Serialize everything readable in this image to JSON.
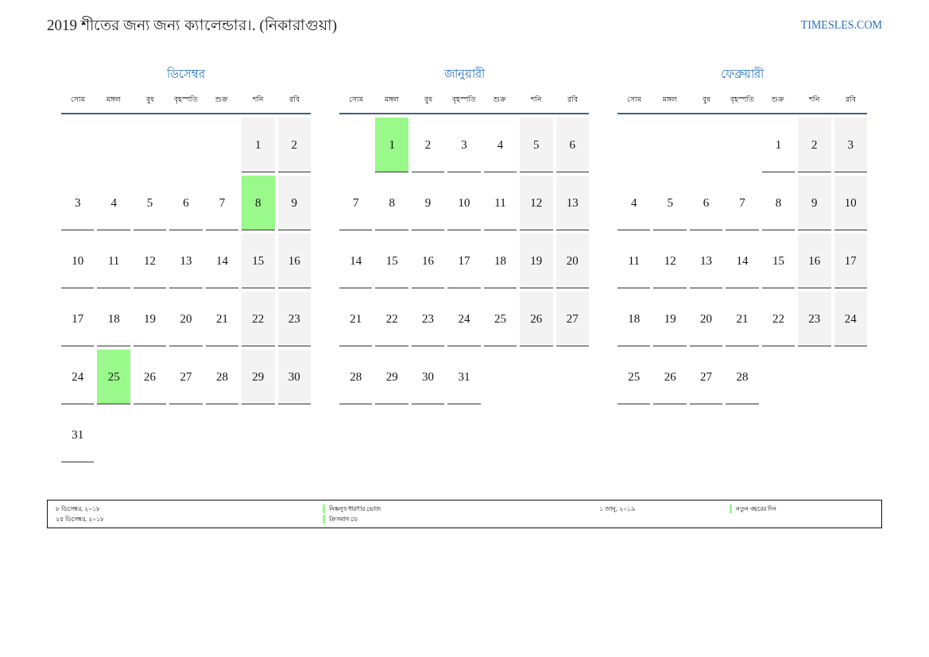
{
  "header": {
    "title": "2019 শীতের জন্য জন্য ক্যালেন্ডার।. (নিকারাগুয়া)",
    "site": "TIMESLES.COM"
  },
  "months": [
    {
      "name": "ডিসেম্বর",
      "weekdays": [
        {
          "label": "সোম",
          "weekend": false
        },
        {
          "label": "মঙ্গল",
          "weekend": false
        },
        {
          "label": "বুধ",
          "weekend": false
        },
        {
          "label": "বৃহস্পতি",
          "weekend": false
        },
        {
          "label": "শুক্র",
          "weekend": false
        },
        {
          "label": "শনি",
          "weekend": true
        },
        {
          "label": "রবি",
          "weekend": true
        }
      ],
      "weeks": [
        [
          {
            "kind": "blank"
          },
          {
            "kind": "blank"
          },
          {
            "kind": "blank"
          },
          {
            "kind": "blank"
          },
          {
            "kind": "blank"
          },
          {
            "kind": "day",
            "day": "1",
            "holiday": false
          },
          {
            "kind": "day",
            "day": "2",
            "holiday": false
          }
        ],
        [
          {
            "kind": "day",
            "day": "3",
            "holiday": false
          },
          {
            "kind": "day",
            "day": "4",
            "holiday": false
          },
          {
            "kind": "day",
            "day": "5",
            "holiday": false
          },
          {
            "kind": "day",
            "day": "6",
            "holiday": false
          },
          {
            "kind": "day",
            "day": "7",
            "holiday": false
          },
          {
            "kind": "day",
            "day": "8",
            "holiday": true
          },
          {
            "kind": "day",
            "day": "9",
            "holiday": false
          }
        ],
        [
          {
            "kind": "day",
            "day": "10",
            "holiday": false
          },
          {
            "kind": "day",
            "day": "11",
            "holiday": false
          },
          {
            "kind": "day",
            "day": "12",
            "holiday": false
          },
          {
            "kind": "day",
            "day": "13",
            "holiday": false
          },
          {
            "kind": "day",
            "day": "14",
            "holiday": false
          },
          {
            "kind": "day",
            "day": "15",
            "holiday": false
          },
          {
            "kind": "day",
            "day": "16",
            "holiday": false
          }
        ],
        [
          {
            "kind": "day",
            "day": "17",
            "holiday": false
          },
          {
            "kind": "day",
            "day": "18",
            "holiday": false
          },
          {
            "kind": "day",
            "day": "19",
            "holiday": false
          },
          {
            "kind": "day",
            "day": "20",
            "holiday": false
          },
          {
            "kind": "day",
            "day": "21",
            "holiday": false
          },
          {
            "kind": "day",
            "day": "22",
            "holiday": false
          },
          {
            "kind": "day",
            "day": "23",
            "holiday": false
          }
        ],
        [
          {
            "kind": "day",
            "day": "24",
            "holiday": false
          },
          {
            "kind": "day",
            "day": "25",
            "holiday": true
          },
          {
            "kind": "day",
            "day": "26",
            "holiday": false
          },
          {
            "kind": "day",
            "day": "27",
            "holiday": false
          },
          {
            "kind": "day",
            "day": "28",
            "holiday": false
          },
          {
            "kind": "day",
            "day": "29",
            "holiday": false
          },
          {
            "kind": "day",
            "day": "30",
            "holiday": false
          }
        ],
        [
          {
            "kind": "day",
            "day": "31",
            "holiday": false
          }
        ]
      ]
    },
    {
      "name": "জানুয়ারী",
      "weekdays": [
        {
          "label": "সোম",
          "weekend": false
        },
        {
          "label": "মঙ্গল",
          "weekend": false
        },
        {
          "label": "বুধ",
          "weekend": false
        },
        {
          "label": "বৃহস্পতি",
          "weekend": false
        },
        {
          "label": "শুক্র",
          "weekend": false
        },
        {
          "label": "শনি",
          "weekend": true
        },
        {
          "label": "রবি",
          "weekend": true
        }
      ],
      "weeks": [
        [
          {
            "kind": "blank"
          },
          {
            "kind": "day",
            "day": "1",
            "holiday": true
          },
          {
            "kind": "day",
            "day": "2",
            "holiday": false
          },
          {
            "kind": "day",
            "day": "3",
            "holiday": false
          },
          {
            "kind": "day",
            "day": "4",
            "holiday": false
          },
          {
            "kind": "day",
            "day": "5",
            "holiday": false
          },
          {
            "kind": "day",
            "day": "6",
            "holiday": false
          }
        ],
        [
          {
            "kind": "day",
            "day": "7",
            "holiday": false
          },
          {
            "kind": "day",
            "day": "8",
            "holiday": false
          },
          {
            "kind": "day",
            "day": "9",
            "holiday": false
          },
          {
            "kind": "day",
            "day": "10",
            "holiday": false
          },
          {
            "kind": "day",
            "day": "11",
            "holiday": false
          },
          {
            "kind": "day",
            "day": "12",
            "holiday": false
          },
          {
            "kind": "day",
            "day": "13",
            "holiday": false
          }
        ],
        [
          {
            "kind": "day",
            "day": "14",
            "holiday": false
          },
          {
            "kind": "day",
            "day": "15",
            "holiday": false
          },
          {
            "kind": "day",
            "day": "16",
            "holiday": false
          },
          {
            "kind": "day",
            "day": "17",
            "holiday": false
          },
          {
            "kind": "day",
            "day": "18",
            "holiday": false
          },
          {
            "kind": "day",
            "day": "19",
            "holiday": false
          },
          {
            "kind": "day",
            "day": "20",
            "holiday": false
          }
        ],
        [
          {
            "kind": "day",
            "day": "21",
            "holiday": false
          },
          {
            "kind": "day",
            "day": "22",
            "holiday": false
          },
          {
            "kind": "day",
            "day": "23",
            "holiday": false
          },
          {
            "kind": "day",
            "day": "24",
            "holiday": false
          },
          {
            "kind": "day",
            "day": "25",
            "holiday": false
          },
          {
            "kind": "day",
            "day": "26",
            "holiday": false
          },
          {
            "kind": "day",
            "day": "27",
            "holiday": false
          }
        ],
        [
          {
            "kind": "day",
            "day": "28",
            "holiday": false
          },
          {
            "kind": "day",
            "day": "29",
            "holiday": false
          },
          {
            "kind": "day",
            "day": "30",
            "holiday": false
          },
          {
            "kind": "day",
            "day": "31",
            "holiday": false
          }
        ]
      ]
    },
    {
      "name": "ফেব্রুয়ারী",
      "weekdays": [
        {
          "label": "সোম",
          "weekend": false
        },
        {
          "label": "মঙ্গল",
          "weekend": false
        },
        {
          "label": "বুধ",
          "weekend": false
        },
        {
          "label": "বৃহস্পতি",
          "weekend": false
        },
        {
          "label": "শুক্র",
          "weekend": false
        },
        {
          "label": "শনি",
          "weekend": true
        },
        {
          "label": "রবি",
          "weekend": true
        }
      ],
      "weeks": [
        [
          {
            "kind": "blank"
          },
          {
            "kind": "blank"
          },
          {
            "kind": "blank"
          },
          {
            "kind": "blank"
          },
          {
            "kind": "day",
            "day": "1",
            "holiday": false
          },
          {
            "kind": "day",
            "day": "2",
            "holiday": false
          },
          {
            "kind": "day",
            "day": "3",
            "holiday": false
          }
        ],
        [
          {
            "kind": "day",
            "day": "4",
            "holiday": false
          },
          {
            "kind": "day",
            "day": "5",
            "holiday": false
          },
          {
            "kind": "day",
            "day": "6",
            "holiday": false
          },
          {
            "kind": "day",
            "day": "7",
            "holiday": false
          },
          {
            "kind": "day",
            "day": "8",
            "holiday": false
          },
          {
            "kind": "day",
            "day": "9",
            "holiday": false
          },
          {
            "kind": "day",
            "day": "10",
            "holiday": false
          }
        ],
        [
          {
            "kind": "day",
            "day": "11",
            "holiday": false
          },
          {
            "kind": "day",
            "day": "12",
            "holiday": false
          },
          {
            "kind": "day",
            "day": "13",
            "holiday": false
          },
          {
            "kind": "day",
            "day": "14",
            "holiday": false
          },
          {
            "kind": "day",
            "day": "15",
            "holiday": false
          },
          {
            "kind": "day",
            "day": "16",
            "holiday": false
          },
          {
            "kind": "day",
            "day": "17",
            "holiday": false
          }
        ],
        [
          {
            "kind": "day",
            "day": "18",
            "holiday": false
          },
          {
            "kind": "day",
            "day": "19",
            "holiday": false
          },
          {
            "kind": "day",
            "day": "20",
            "holiday": false
          },
          {
            "kind": "day",
            "day": "21",
            "holiday": false
          },
          {
            "kind": "day",
            "day": "22",
            "holiday": false
          },
          {
            "kind": "day",
            "day": "23",
            "holiday": false
          },
          {
            "kind": "day",
            "day": "24",
            "holiday": false
          }
        ],
        [
          {
            "kind": "day",
            "day": "25",
            "holiday": false
          },
          {
            "kind": "day",
            "day": "26",
            "holiday": false
          },
          {
            "kind": "day",
            "day": "27",
            "holiday": false
          },
          {
            "kind": "day",
            "day": "28",
            "holiday": false
          }
        ]
      ]
    }
  ],
  "legend": {
    "groups": [
      {
        "entries": [
          {
            "date": "৮ ডিসেম্বর, ২০১৮",
            "name": "নিষ্কলুষ ধারণার ভোজ"
          },
          {
            "date": "২৫ ডিসেম্বর, ২০১৮",
            "name": "ক্রিসমাস ডে"
          }
        ]
      },
      {
        "entries": [
          {
            "date": "১ জানু, ২০১৯",
            "name": "নতুন বছরের দিন"
          }
        ]
      }
    ]
  }
}
